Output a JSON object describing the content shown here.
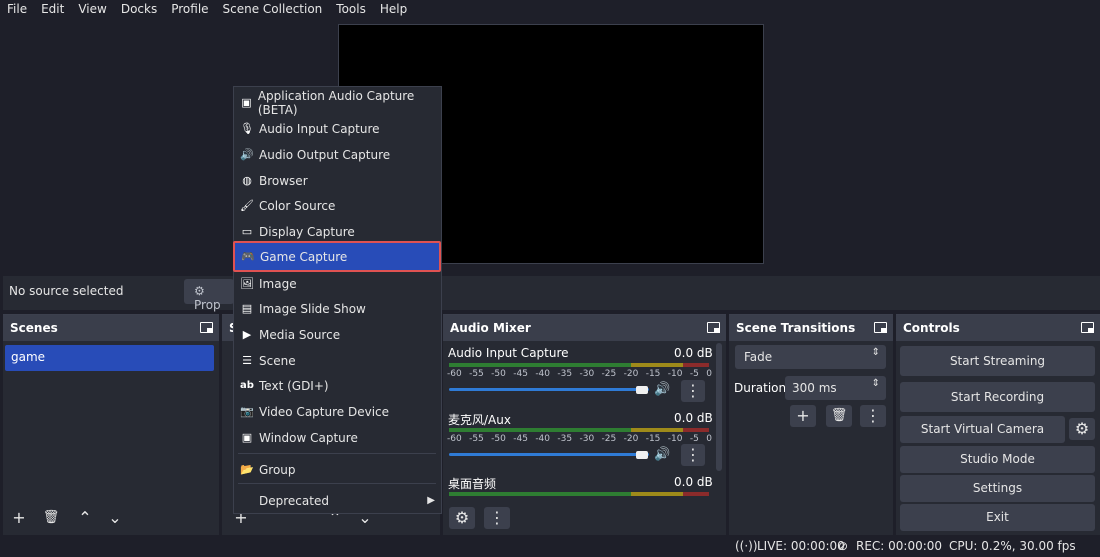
{
  "menubar": [
    "File",
    "Edit",
    "View",
    "Docks",
    "Profile",
    "Scene Collection",
    "Tools",
    "Help"
  ],
  "context": {
    "no_source": "No source selected",
    "properties": "Prop"
  },
  "scenes": {
    "title": "Scenes",
    "items": [
      "game"
    ]
  },
  "sources": {
    "title": "S"
  },
  "add_source_menu": [
    {
      "label": "Application Audio Capture (BETA)",
      "icon": "app-audio-icon"
    },
    {
      "label": "Audio Input Capture",
      "icon": "microphone-icon"
    },
    {
      "label": "Audio Output Capture",
      "icon": "speaker-icon"
    },
    {
      "label": "Browser",
      "icon": "globe-icon"
    },
    {
      "label": "Color Source",
      "icon": "brush-icon"
    },
    {
      "label": "Display Capture",
      "icon": "monitor-icon"
    },
    {
      "label": "Game Capture",
      "icon": "gamepad-icon"
    },
    {
      "label": "Image",
      "icon": "image-icon"
    },
    {
      "label": "Image Slide Show",
      "icon": "slideshow-icon"
    },
    {
      "label": "Media Source",
      "icon": "play-icon"
    },
    {
      "label": "Scene",
      "icon": "list-icon"
    },
    {
      "label": "Text (GDI+)",
      "icon": "text-icon"
    },
    {
      "label": "Video Capture Device",
      "icon": "camera-icon"
    },
    {
      "label": "Window Capture",
      "icon": "window-icon"
    },
    {
      "label": "Group",
      "icon": "folder-icon"
    },
    {
      "label": "Deprecated",
      "icon": ""
    }
  ],
  "mixer": {
    "title": "Audio Mixer",
    "channels": [
      {
        "name": "Audio Input Capture",
        "db": "0.0 dB"
      },
      {
        "name": "麦克风/Aux",
        "db": "0.0 dB"
      },
      {
        "name": "桌面音频",
        "db": "0.0 dB"
      }
    ],
    "ticks": [
      "-60",
      "-55",
      "-50",
      "-45",
      "-40",
      "-35",
      "-30",
      "-25",
      "-20",
      "-15",
      "-10",
      "-5",
      "0"
    ]
  },
  "transitions": {
    "title": "Scene Transitions",
    "type": "Fade",
    "duration_label": "Duration",
    "duration": "300 ms"
  },
  "controls": {
    "title": "Controls",
    "start_streaming": "Start Streaming",
    "start_recording": "Start Recording",
    "start_virtual_camera": "Start Virtual Camera",
    "studio_mode": "Studio Mode",
    "settings": "Settings",
    "exit": "Exit"
  },
  "status": {
    "live": "LIVE: 00:00:00",
    "rec": "REC: 00:00:00",
    "cpu": "CPU: 0.2%, 30.00 fps"
  },
  "colors": {
    "selection": "#284cb8",
    "highlight_border": "#e05252",
    "panel": "#272a33",
    "background": "#1e1f29"
  }
}
